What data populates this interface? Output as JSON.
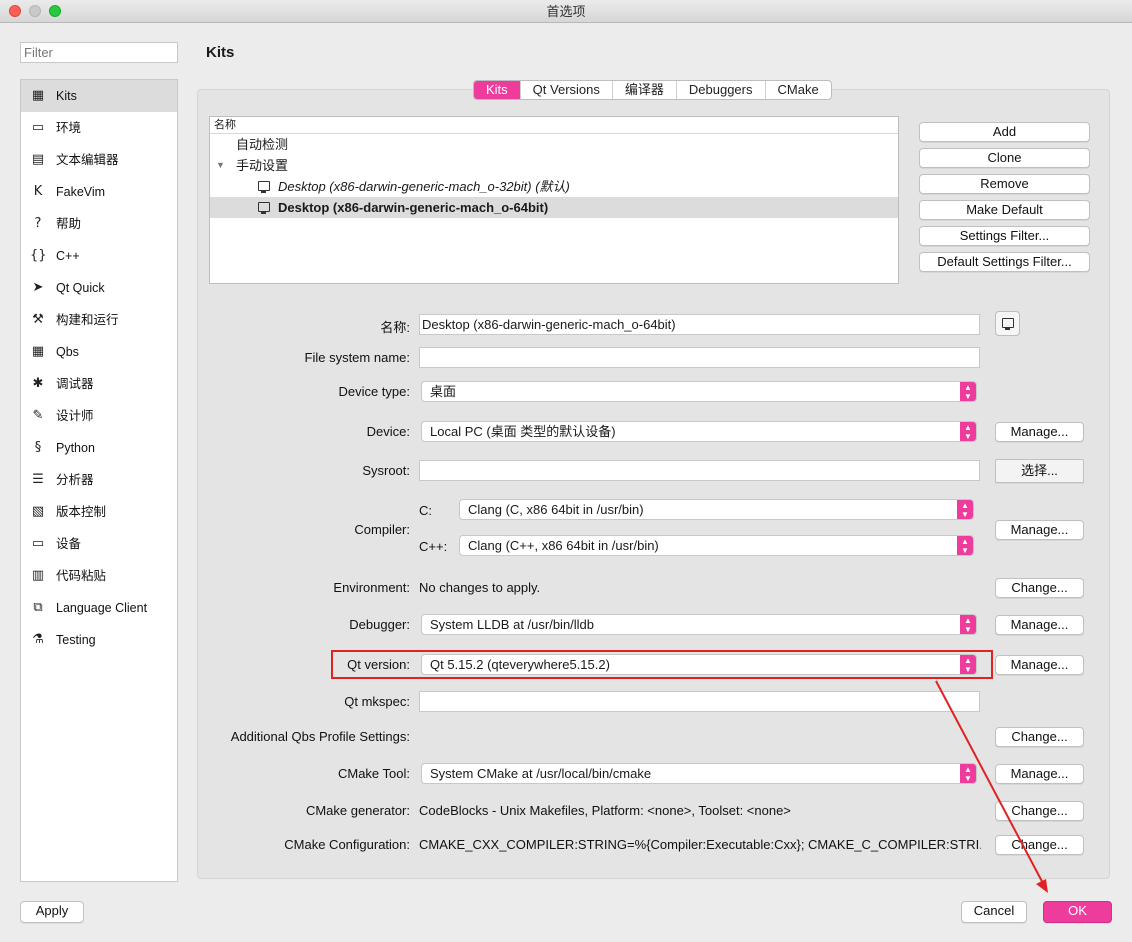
{
  "window": {
    "title": "首选项"
  },
  "filter": {
    "placeholder": "Filter"
  },
  "sidebar": {
    "items": [
      {
        "label": "Kits",
        "icon": "kits-icon",
        "glyph": "▦"
      },
      {
        "label": "环境",
        "icon": "monitor-icon",
        "glyph": "▭"
      },
      {
        "label": "文本编辑器",
        "icon": "text-editor-icon",
        "glyph": "▤"
      },
      {
        "label": "FakeVim",
        "icon": "fakevim-icon",
        "glyph": "K"
      },
      {
        "label": "帮助",
        "icon": "help-icon",
        "glyph": "?"
      },
      {
        "label": "C++",
        "icon": "braces-icon",
        "glyph": "{}"
      },
      {
        "label": "Qt Quick",
        "icon": "paper-plane-icon",
        "glyph": "➤"
      },
      {
        "label": "构建和运行",
        "icon": "hammer-icon",
        "glyph": "⚒"
      },
      {
        "label": "Qbs",
        "icon": "qbs-icon",
        "glyph": "▦"
      },
      {
        "label": "调试器",
        "icon": "bug-icon",
        "glyph": "✱"
      },
      {
        "label": "设计师",
        "icon": "pen-icon",
        "glyph": "✎"
      },
      {
        "label": "Python",
        "icon": "python-icon",
        "glyph": "§"
      },
      {
        "label": "分析器",
        "icon": "analyzer-icon",
        "glyph": "☰"
      },
      {
        "label": "版本控制",
        "icon": "version-control-icon",
        "glyph": "▧"
      },
      {
        "label": "设备",
        "icon": "device-icon",
        "glyph": "▭"
      },
      {
        "label": "代码粘贴",
        "icon": "clipboard-icon",
        "glyph": "▥"
      },
      {
        "label": "Language Client",
        "icon": "language-client-icon",
        "glyph": "⧉"
      },
      {
        "label": "Testing",
        "icon": "flask-icon",
        "glyph": "⚗"
      }
    ]
  },
  "page": {
    "title": "Kits"
  },
  "tabs": [
    "Kits",
    "Qt Versions",
    "编译器",
    "Debuggers",
    "CMake"
  ],
  "kit_tree": {
    "header": "名称",
    "auto_detected": "自动检测",
    "manual": "手动设置",
    "kits": [
      {
        "label": "Desktop (x86-darwin-generic-mach_o-32bit) (默认)",
        "selected": false,
        "italic": true
      },
      {
        "label": "Desktop (x86-darwin-generic-mach_o-64bit)",
        "selected": true,
        "italic": false
      }
    ]
  },
  "kit_buttons": {
    "add": "Add",
    "clone": "Clone",
    "remove": "Remove",
    "make_default": "Make Default",
    "settings_filter": "Settings Filter...",
    "default_settings_filter": "Default Settings Filter..."
  },
  "form": {
    "name_label": "名称:",
    "name_value": "Desktop (x86-darwin-generic-mach_o-64bit)",
    "fs_name_label": "File system name:",
    "fs_name_value": "",
    "device_type_label": "Device type:",
    "device_type_value": "桌面",
    "device_label": "Device:",
    "device_value": "Local PC (桌面 类型的默认设备)",
    "device_button": "Manage...",
    "sysroot_label": "Sysroot:",
    "sysroot_value": "",
    "sysroot_button": "选择...",
    "compiler_label": "Compiler:",
    "compiler_c_label": "C:",
    "compiler_c_value": "Clang (C, x86 64bit in /usr/bin)",
    "compiler_cpp_label": "C++:",
    "compiler_cpp_value": "Clang (C++, x86 64bit in /usr/bin)",
    "compiler_button": "Manage...",
    "environment_label": "Environment:",
    "environment_value": "No changes to apply.",
    "environment_button": "Change...",
    "debugger_label": "Debugger:",
    "debugger_value": "System LLDB at /usr/bin/lldb",
    "debugger_button": "Manage...",
    "qt_version_label": "Qt version:",
    "qt_version_value": "Qt 5.15.2 (qteverywhere5.15.2)",
    "qt_version_button": "Manage...",
    "qt_mkspec_label": "Qt mkspec:",
    "qt_mkspec_value": "",
    "qbs_label": "Additional Qbs Profile Settings:",
    "qbs_button": "Change...",
    "cmake_tool_label": "CMake Tool:",
    "cmake_tool_value": "System CMake at /usr/local/bin/cmake",
    "cmake_tool_button": "Manage...",
    "cmake_generator_label": "CMake generator:",
    "cmake_generator_value": "CodeBlocks - Unix Makefiles, Platform: <none>, Toolset: <none>",
    "cmake_generator_button": "Change...",
    "cmake_config_label": "CMake Configuration:",
    "cmake_config_value": "CMAKE_CXX_COMPILER:STRING=%{Compiler:Executable:Cxx}; CMAKE_C_COMPILER:STRI...",
    "cmake_config_button": "Change..."
  },
  "footer": {
    "apply": "Apply",
    "cancel": "Cancel",
    "ok": "OK"
  },
  "colors": {
    "accent": "#ee3c9c",
    "annotation": "#e02222"
  }
}
